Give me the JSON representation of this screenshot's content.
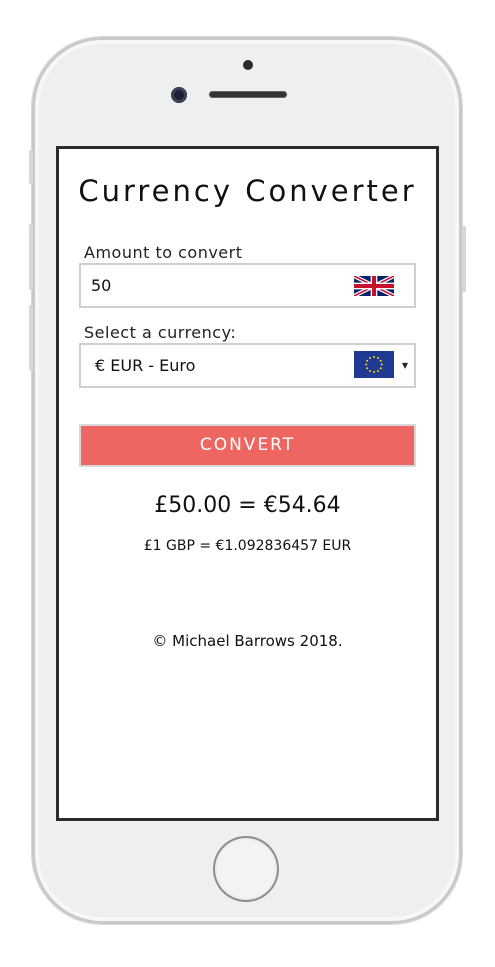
{
  "app": {
    "title": "Currency Converter",
    "amount_label": "Amount to convert",
    "amount_value": "50",
    "amount_flag": "uk-flag-icon",
    "currency_label": "Select a currency:",
    "currency_selected": "€ EUR - Euro",
    "currency_flag": "eu-flag-icon",
    "dropdown_arrow": "▾",
    "convert_button": "CONVERT",
    "result": "£50.00 = €54.64",
    "rate": "£1 GBP = €1.092836457 EUR",
    "footer": "© Michael Barrows 2018."
  },
  "colors": {
    "button_bg": "#ee6662",
    "button_text": "#ffffff",
    "screen_border": "#2b2b2b",
    "phone_body": "#eeeff1"
  }
}
